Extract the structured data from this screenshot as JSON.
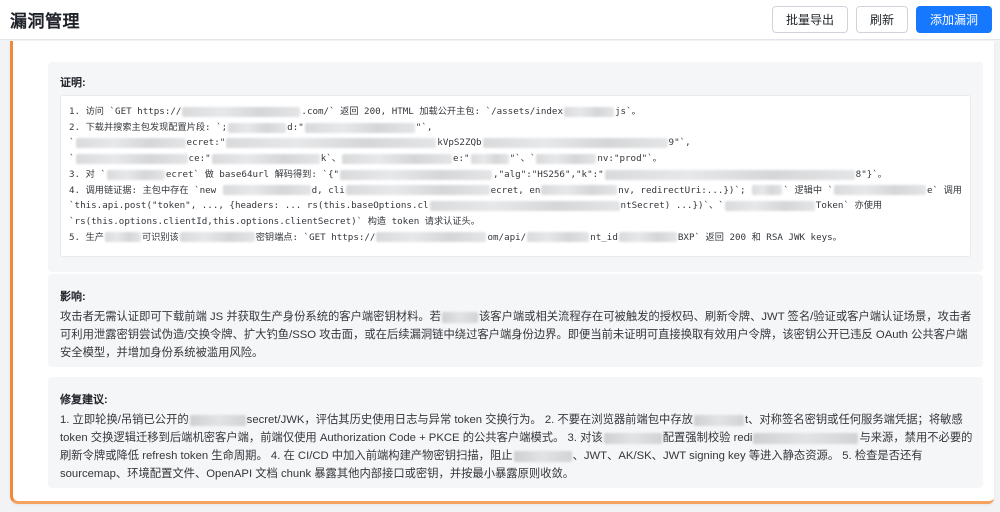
{
  "header": {
    "title": "漏洞管理",
    "buttons": {
      "export": "批量导出",
      "refresh": "刷新",
      "add": "添加漏洞"
    }
  },
  "colors": {
    "primary": "#1677ff",
    "card_accent": "#f0883e",
    "redaction": "#d9dadc"
  },
  "proof": {
    "title": "证明:",
    "lines": [
      [
        "1. 访问 `GET https://",
        "@",
        ".com/` 返回 200, HTML 加载公开主包: `/assets/index",
        "@",
        "js`。"
      ],
      [
        "2. 下载并搜索主包发现配置片段: `;",
        "@",
        "d:\"",
        "@",
        "\"`,"
      ],
      [
        "`",
        "@",
        "ecret:\"",
        "@",
        "kVpS2ZQb",
        "@",
        "9\"`,"
      ],
      [
        "`",
        "@",
        "ce:\"",
        "@",
        "k`、",
        "@",
        "e:\"",
        "@",
        "\"`、`",
        "@",
        "nv:\"prod\"`。"
      ],
      [
        "3. 对 `",
        "@",
        "ecret` 做 base64url 解码得到: `{\"",
        "@",
        ",\"alg\":\"HS256\",\"k\":\"",
        "@",
        "8\"}`。"
      ],
      [
        "4. 调用链证据: 主包中存在 `new ",
        "@",
        "d, cli",
        "@",
        "ecret, en",
        "@",
        "nv, redirectUri:...})`; ",
        "@",
        "` 逻辑中 `",
        "@",
        "e` 调用"
      ],
      [
        "`this.api.post(\"token\", ..., {headers: ... rs(this.baseOptions.cl",
        "@",
        "ntSecret) ...})`、`",
        "@",
        "Token` 亦使用"
      ],
      [
        "`rs(this.options.clientId,this.options.clientSecret)` 构造 token 请求认证头。"
      ],
      [
        "5. 生产",
        "@",
        "可识别该",
        "@",
        "密钥端点: `GET https://",
        "@",
        "om/api/",
        "@",
        "nt_id",
        "@",
        "BXP` 返回 200 和 RSA JWK keys。"
      ]
    ],
    "redaction_widths": [
      [
        118,
        50
      ],
      [
        58,
        110
      ],
      [
        110,
        210,
        185
      ],
      [
        112,
        108,
        110,
        38
      ],
      [
        58,
        152,
        250
      ],
      [
        110,
        180,
        95,
        38,
        115
      ],
      [
        190,
        90
      ],
      [],
      [
        36,
        75,
        110,
        62,
        58
      ]
    ]
  },
  "impact": {
    "title": "影响:",
    "parts": [
      "攻击者无需认证即可下载前端 JS 并获取生产身份系统的客户端密钥材料。若",
      "@",
      "该客户端或相关流程存在可被触发的授权码、刷新令牌、JWT 签名/验证或客户端认证场景，攻击者可利用泄露密钥尝试伪造/交换令牌、扩大钓鱼/SSO 攻击面，或在后续漏洞链中绕过客户端身份边界。即便当前未证明可直接换取有效用户令牌，该密钥公开已违反 OAuth 公共客户端安全模型，并增加身份系统被滥用风险。"
    ],
    "redaction_widths": [
      36
    ]
  },
  "fix": {
    "title": "修复建议:",
    "parts": [
      "1. 立即轮换/吊销已公开的",
      "@",
      "secret/JWK，评估其历史使用日志与异常 token 交换行为。 2. 不要在浏览器前端包中存放",
      "@",
      "t、对称签名密钥或任何服务端凭据；将敏感 token 交换逻辑迁移到后端机密客户端，前端仅使用 Authorization Code + PKCE 的公共客户端模式。 3. 对该",
      "@",
      "配置强制校验 redi",
      "@",
      "与来源，禁用不必要的刷新令牌或降低 refresh token 生命周期。 4. 在 CI/CD 中加入前端构建产物密钥扫描，阻止",
      "@",
      "、JWT、AK/SK、JWT signing key 等进入静态资源。 5. 检查是否还有 sourcemap、环境配置文件、OpenAPI 文档 chunk 暴露其他内部接口或密钥，并按最小暴露原则收敛。"
    ],
    "redaction_widths": [
      56,
      50,
      58,
      105,
      58
    ]
  }
}
